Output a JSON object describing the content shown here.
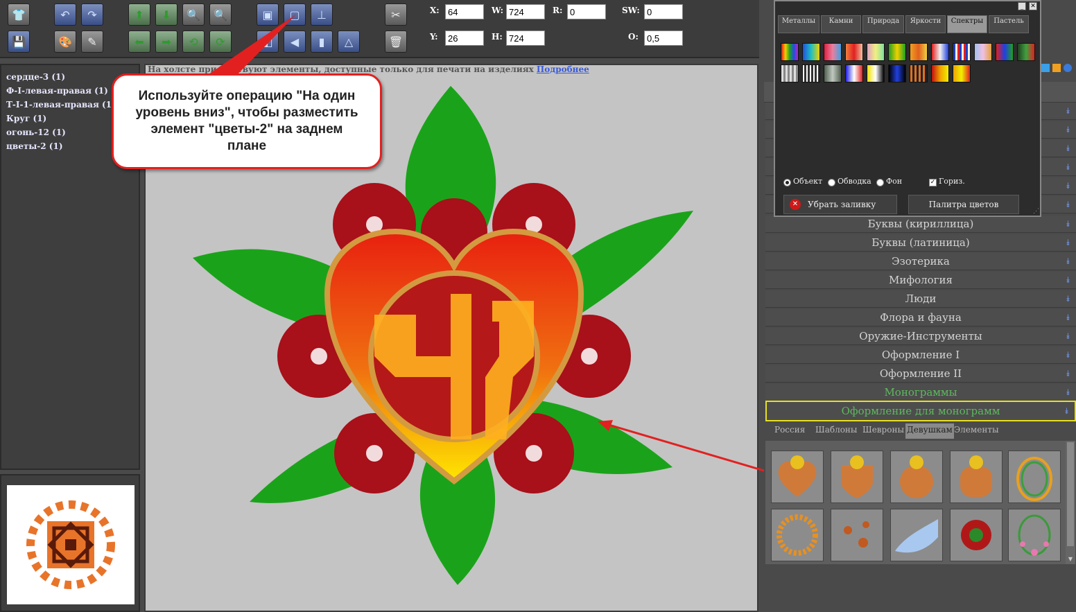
{
  "toolbar": {
    "coords": {
      "x_label": "X:",
      "x_value": "64",
      "w_label": "W:",
      "w_value": "724",
      "r_label": "R:",
      "r_value": "0",
      "sw_label": "SW:",
      "sw_value": "0",
      "y_label": "Y:",
      "y_value": "26",
      "h_label": "H:",
      "h_value": "724",
      "o_label": "O:",
      "o_value": "0,5"
    }
  },
  "layers": [
    "сердце-3 (1)",
    "Ф-I-левая-правая (1)",
    "Т-I-1-левая-правая (1)",
    "Круг (1)",
    "огонь-12 (1)",
    "цветы-2 (1)"
  ],
  "canvas": {
    "notice": "На холсте присутствуют элементы, доступные только для печати на изделиях",
    "notice_link": "Подробнее"
  },
  "callout": {
    "text": "Используйте операцию \"На один уровень вниз\", чтобы разместить элемент \"цветы-2\" на заднем плане"
  },
  "fill_window": {
    "tabs": [
      "Металлы",
      "Камни",
      "Природа",
      "Яркости",
      "Спектры",
      "Пастель"
    ],
    "active_tab": "Спектры",
    "radio_object": "Объект",
    "radio_stroke": "Обводка",
    "radio_bg": "Фон",
    "checkbox_horiz": "Гориз.",
    "remove_fill": "Убрать заливку",
    "palette": "Палитра цветов"
  },
  "categories": [
    "Буквы (кириллица)",
    "Буквы (латиница)",
    "Эзотерика",
    "Мифология",
    "Люди",
    "Флора и фауна",
    "Оружие-Инструменты",
    "Оформление I",
    "Оформление II",
    "Монограммы",
    "Оформление для монограмм"
  ],
  "subtabs": [
    "Россия",
    "Шаблоны",
    "Шевроны",
    "Девушкам",
    "Элементы"
  ],
  "active_subtab": "Девушкам"
}
